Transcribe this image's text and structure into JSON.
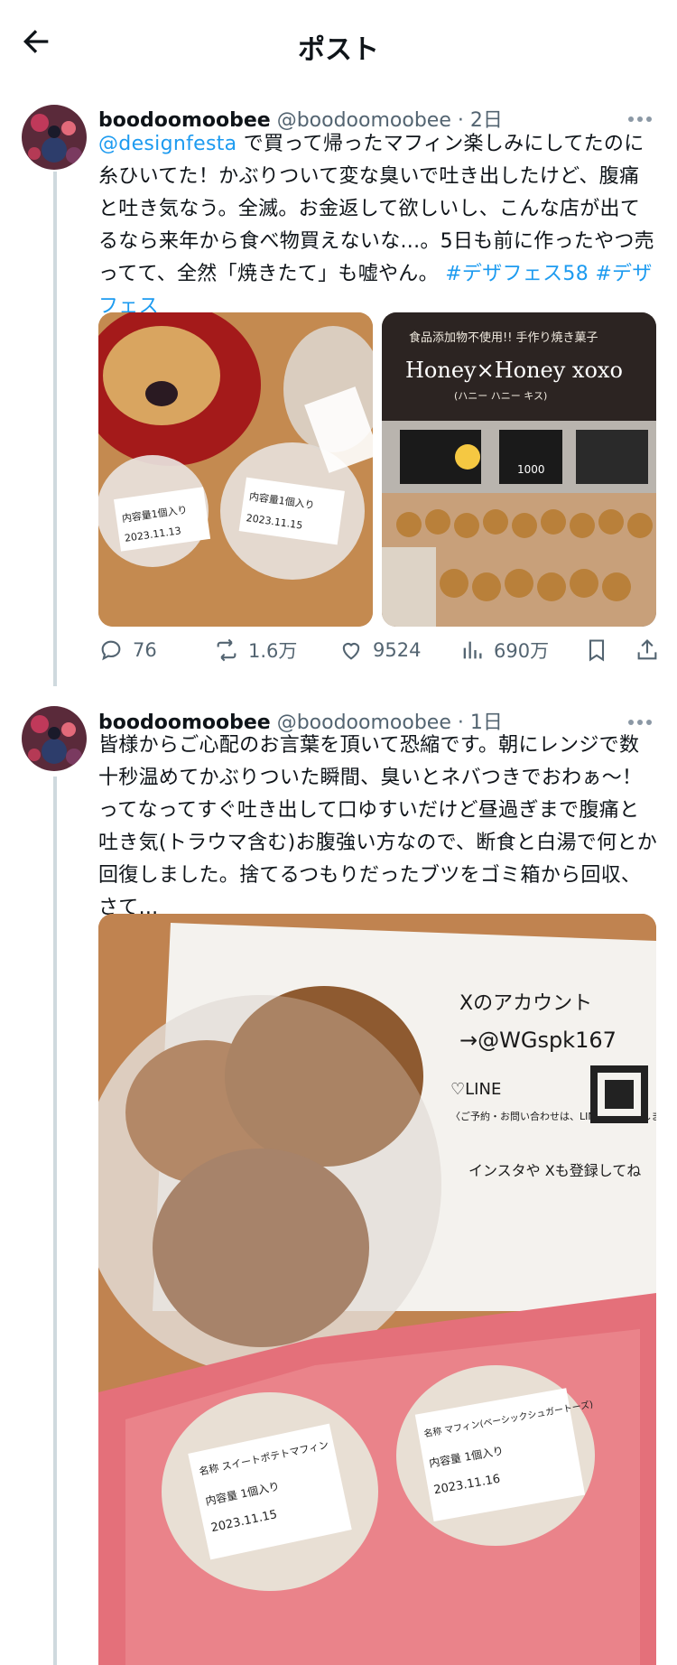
{
  "header": {
    "title": "ポスト"
  },
  "posts": [
    {
      "name": "boodoomoobee",
      "handle": "@boodoomoobee",
      "time": "· 2日",
      "text_mention": "@designfesta",
      "text_body": " で買って帰ったマフィン楽しみにしてたのに糸ひいてた！かぶりついて変な臭いで吐き出したけど、腹痛と吐き気なう。全滅。お金返して欲しいし、こんな店が出てるなら来年から食べ物買えないな...。5日も前に作ったやつ売ってて、全然「焼きたて」も嘘やん。",
      "hashtag1": " #デザフェス58",
      "hashtag2": " #デザフェス",
      "image1": {
        "label_date1": "2023.11.13",
        "label_date2": "2023.11.15",
        "label_content": "内容量1個入り"
      },
      "image2": {
        "sign_top": "食品添加物不使用!! 手作り焼き菓子",
        "sign_main": "Honey×Honey xoxo",
        "sign_sub": "(ハニー ハニー キス)",
        "price": "1000"
      },
      "stats": {
        "replies": "76",
        "reposts": "1.6万",
        "likes": "9524",
        "views": "690万"
      }
    },
    {
      "name": "boodoomoobee",
      "handle": "@boodoomoobee",
      "time": "· 1日",
      "text_body": "皆様からご心配のお言葉を頂いて恐縮です。朝にレンジで数十秒温めてかぶりついた瞬間、臭いとネバつきでおわぁ〜！ってなってすぐ吐き出して口ゆすいだけど昼過ぎまで腹痛と吐き気(トラウマ含む)お腹強い方なので、断食と白湯で何とか回復しました。捨てるつもりだったブツをゴミ箱から回収、さて...",
      "image": {
        "paper_account": "Xのアカウント",
        "paper_handle": "→@WGspk167",
        "paper_line": "♡LINE",
        "paper_line_note": "〈ご予約・お問い合わせは、LINEにお願いします。〉",
        "paper_insta": "インスタや Xも登録してね",
        "label1_name": "名称 スイートポテトマフィン",
        "label1_qty": "内容量 1個入り",
        "label1_date": "2023.11.15",
        "label2_name": "名称 マフィン(ベーシックシュガートーズ)",
        "label2_qty": "内容量 1個入り",
        "label2_date": "2023.11.16"
      }
    }
  ],
  "colors": {
    "link": "#1d9bf0",
    "muted": "#536471",
    "line": "#cfd9de"
  }
}
